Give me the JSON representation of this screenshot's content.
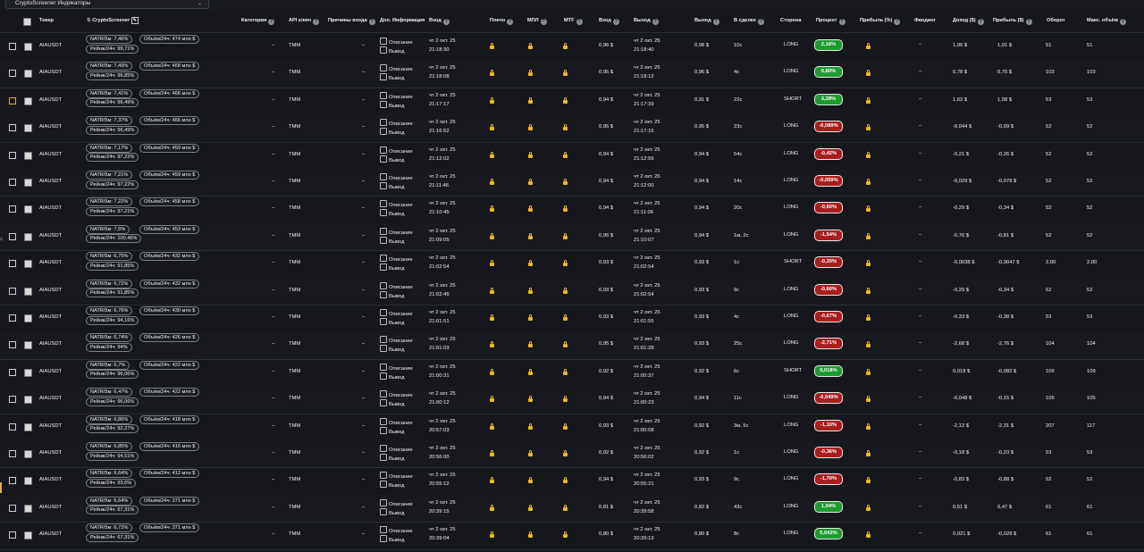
{
  "toolbar": {
    "dropdown_label": "CryptoScreener Индикаторы",
    "dropdown_arrow": "⌄"
  },
  "columns": {
    "ticker": "Тикер",
    "cryptoscreener": "CryptoScreener",
    "category": "Категория",
    "api_key": "API ключ",
    "entry_reasons": "Причины входа",
    "extra_info": "Доп. Информация",
    "entry": "Вход",
    "leverage": "Плечо",
    "mtf1": "МПЛ",
    "mtf2": "MTF",
    "entry_price": "Вход",
    "exit": "Выход",
    "exit_price": "Выход",
    "in_trade": "В сделке",
    "side": "Сторона",
    "percent": "Процент",
    "profit_pct": "Прибыль (%)",
    "funding": "Фандинг",
    "income": "Доход ($)",
    "profit_usd": "Прибыль ($)",
    "turnover": "Оборот",
    "max_volume": "Макс. объём"
  },
  "labels": {
    "description": "Описание",
    "conclusion": "Вывод"
  },
  "colors": {
    "positive": "#1c9b2e",
    "negative": "#a81d1d",
    "lock": "#e8b923",
    "background": "#15171c"
  },
  "rows": [
    {
      "ticker": "AIAUSDT",
      "natr": "NATR/5м: 7,46%",
      "vol": "Объём/24ч: 474 млн $",
      "chg": "Рейнж/24ч: 99,71%",
      "cat": "–",
      "api": "TMM",
      "reason": "–",
      "entry_date": "чт 2 окт. 25",
      "entry_time": "21:18:30",
      "entry_price": "0,96 $",
      "exit_date": "чт 2 окт. 25",
      "exit_time": "21:18:40",
      "exit_price": "0,98 $",
      "dur": "10с",
      "side": "LONG",
      "pct": "2,16%",
      "pos": true,
      "funding": "–",
      "income": "1,06 $",
      "profit": "1,01 $",
      "turnover": "51",
      "maxvol": "51"
    },
    {
      "ticker": "AIAUSDT",
      "natr": "NATR/5м: 7,49%",
      "vol": "Объём/24ч: 468 млн $",
      "chg": "Рейнж/24ч: 96,85%",
      "cat": "–",
      "api": "TMM",
      "reason": "–",
      "entry_date": "чт 2 окт. 25",
      "entry_time": "21:18:08",
      "entry_price": "0,95 $",
      "exit_date": "чт 2 окт. 25",
      "exit_time": "21:18:12",
      "exit_price": "0,96 $",
      "dur": "4с",
      "side": "LONG",
      "pct": "0,80%",
      "pos": true,
      "funding": "–",
      "income": "0,78 $",
      "profit": "0,70 $",
      "turnover": "103",
      "maxvol": "103"
    },
    {
      "ticker": "AIAUSDT",
      "natr": "NATR/5м: 7,41%",
      "vol": "Объём/24ч: 466 млн $",
      "chg": "Рейнж/24ч: 96,49%",
      "cat": "–",
      "api": "TMM",
      "reason": "–",
      "entry_date": "чт 2 окт. 25",
      "entry_time": "21:17:17",
      "entry_price": "0,94 $",
      "exit_date": "чт 2 окт. 25",
      "exit_time": "21:17:39",
      "exit_price": "0,91 $",
      "dur": "22с",
      "side": "SHORT",
      "pct": "3,28%",
      "pos": true,
      "funding": "–",
      "income": "1,63 $",
      "profit": "1,58 $",
      "turnover": "53",
      "maxvol": "53",
      "gold": true
    },
    {
      "ticker": "AIAUSDT",
      "natr": "NATR/5м: 7,37%",
      "vol": "Объём/24ч: 466 млн $",
      "chg": "Рейнж/24ч: 96,49%",
      "cat": "–",
      "api": "TMM",
      "reason": "–",
      "entry_date": "чт 2 окт. 25",
      "entry_time": "21:16:52",
      "entry_price": "0,95 $",
      "exit_date": "чт 2 окт. 25",
      "exit_time": "21:17:15",
      "exit_price": "0,95 $",
      "dur": "23с",
      "side": "LONG",
      "pct": "-0,089%",
      "pos": false,
      "funding": "–",
      "income": "-0,044 $",
      "profit": "-0,09 $",
      "turnover": "52",
      "maxvol": "52"
    },
    {
      "ticker": "AIAUSDT",
      "natr": "NATR/5м: 7,17%",
      "vol": "Объём/24ч: 459 млн $",
      "chg": "Рейнж/24ч: 97,22%",
      "cat": "–",
      "api": "TMM",
      "reason": "–",
      "entry_date": "чт 2 окт. 25",
      "entry_time": "21:12:02",
      "entry_price": "0,94 $",
      "exit_date": "чт 2 окт. 25",
      "exit_time": "21:12:56",
      "exit_price": "0,94 $",
      "dur": "54с",
      "side": "LONG",
      "pct": "-0,42%",
      "pos": false,
      "funding": "–",
      "income": "-0,21 $",
      "profit": "-0,26 $",
      "turnover": "52",
      "maxvol": "52"
    },
    {
      "ticker": "AIAUSDT",
      "natr": "NATR/5м: 7,21%",
      "vol": "Объём/24ч: 459 млн $",
      "chg": "Рейнж/24ч: 97,22%",
      "cat": "–",
      "api": "TMM",
      "reason": "–",
      "entry_date": "чт 2 окт. 25",
      "entry_time": "21:11:46",
      "entry_price": "0,94 $",
      "exit_date": "чт 2 окт. 25",
      "exit_time": "21:12:00",
      "exit_price": "0,94 $",
      "dur": "14с",
      "side": "LONG",
      "pct": "-0,059%",
      "pos": false,
      "funding": "–",
      "income": "-0,029 $",
      "profit": "-0,078 $",
      "turnover": "52",
      "maxvol": "52"
    },
    {
      "ticker": "AIAUSDT",
      "natr": "NATR/5м: 7,22%",
      "vol": "Объём/24ч: 458 млн $",
      "chg": "Рейнж/24ч: 97,21%",
      "cat": "–",
      "api": "TMM",
      "reason": "–",
      "entry_date": "чт 2 окт. 25",
      "entry_time": "21:10:45",
      "entry_price": "0,94 $",
      "exit_date": "чт 2 окт. 25",
      "exit_time": "21:11:06",
      "exit_price": "0,94 $",
      "dur": "20с",
      "side": "LONG",
      "pct": "-0,60%",
      "pos": false,
      "funding": "–",
      "income": "-0,29 $",
      "profit": "-0,34 $",
      "turnover": "52",
      "maxvol": "52"
    },
    {
      "ticker": "AIAUSDT",
      "natr": "NATR/5м: 7,5%",
      "vol": "Объём/24ч: 453 млн $",
      "chg": "Рейнж/24ч: 100,46%",
      "cat": "–",
      "api": "TMM",
      "reason": "–",
      "entry_date": "чт 2 окт. 25",
      "entry_time": "21:09:05",
      "entry_price": "0,95 $",
      "exit_date": "чт 2 окт. 25",
      "exit_time": "21:10:07",
      "exit_price": "0,94 $",
      "dur": "1м, 2с",
      "side": "LONG",
      "pct": "-1,54%",
      "pos": false,
      "funding": "–",
      "income": "-0,76 $",
      "profit": "-0,81 $",
      "turnover": "52",
      "maxvol": "52"
    },
    {
      "ticker": "AIAUSDT",
      "natr": "NATR/5м: 6,75%",
      "vol": "Объём/24ч: 432 млн $",
      "chg": "Рейнж/24ч: 91,85%",
      "cat": "–",
      "api": "TMM",
      "reason": "–",
      "entry_date": "чт 2 окт. 25",
      "entry_time": "21:02:54",
      "entry_price": "0,93 $",
      "exit_date": "чт 2 окт. 25",
      "exit_time": "21:02:54",
      "exit_price": "0,93 $",
      "dur": "1с",
      "side": "SHORT",
      "pct": "-0,20%",
      "pos": false,
      "funding": "–",
      "income": "-0,0038 $",
      "profit": "-0,0047 $",
      "turnover": "2,00",
      "maxvol": "2,00"
    },
    {
      "ticker": "AIAUSDT",
      "natr": "NATR/5м: 6,72%",
      "vol": "Объём/24ч: 432 млн $",
      "chg": "Рейнж/24ч: 91,85%",
      "cat": "–",
      "api": "TMM",
      "reason": "–",
      "entry_date": "чт 2 окт. 25",
      "entry_time": "21:02:45",
      "entry_price": "0,93 $",
      "exit_date": "чт 2 окт. 25",
      "exit_time": "21:02:54",
      "exit_price": "0,93 $",
      "dur": "9с",
      "side": "LONG",
      "pct": "-0,60%",
      "pos": false,
      "funding": "–",
      "income": "-0,29 $",
      "profit": "-0,34 $",
      "turnover": "52",
      "maxvol": "52"
    },
    {
      "ticker": "AIAUSDT",
      "natr": "NATR/5м: 6,76%",
      "vol": "Объём/24ч: 430 млн $",
      "chg": "Рейнж/24ч: 94,16%",
      "cat": "–",
      "api": "TMM",
      "reason": "–",
      "entry_date": "чт 2 окт. 25",
      "entry_time": "21:01:51",
      "entry_price": "0,93 $",
      "exit_date": "чт 2 окт. 25",
      "exit_time": "21:01:55",
      "exit_price": "0,93 $",
      "dur": "4с",
      "side": "LONG",
      "pct": "-0,67%",
      "pos": false,
      "funding": "–",
      "income": "-0,33 $",
      "profit": "-0,38 $",
      "turnover": "53",
      "maxvol": "53"
    },
    {
      "ticker": "AIAUSDT",
      "natr": "NATR/5м: 6,74%",
      "vol": "Объём/24ч: 426 млн $",
      "chg": "Рейнж/24ч: 94%",
      "cat": "–",
      "api": "TMM",
      "reason": "–",
      "entry_date": "чт 2 окт. 25",
      "entry_time": "21:01:03",
      "entry_price": "0,95 $",
      "exit_date": "чт 2 окт. 25",
      "exit_time": "21:01:28",
      "exit_price": "0,93 $",
      "dur": "25с",
      "side": "LONG",
      "pct": "-2,71%",
      "pos": false,
      "funding": "–",
      "income": "-2,68 $",
      "profit": "-2,76 $",
      "turnover": "104",
      "maxvol": "104"
    },
    {
      "ticker": "AIAUSDT",
      "natr": "NATR/5м: 6,7%",
      "vol": "Объём/24ч: 422 млн $",
      "chg": "Рейнж/24ч: 96,06%",
      "cat": "–",
      "api": "TMM",
      "reason": "–",
      "entry_date": "чт 2 окт. 25",
      "entry_time": "21:00:31",
      "entry_price": "0,92 $",
      "exit_date": "чт 2 окт. 25",
      "exit_time": "21:00:37",
      "exit_price": "0,92 $",
      "dur": "6с",
      "side": "SHORT",
      "pct": "0,018%",
      "pos": true,
      "funding": "–",
      "income": "0,018 $",
      "profit": "-0,082 $",
      "turnover": "109",
      "maxvol": "109"
    },
    {
      "ticker": "AIAUSDT",
      "natr": "NATR/5м: 6,47%",
      "vol": "Объём/24ч: 422 млн $",
      "chg": "Рейнж/24ч: 96,06%",
      "cat": "–",
      "api": "TMM",
      "reason": "–",
      "entry_date": "чт 2 окт. 25",
      "entry_time": "21:00:12",
      "entry_price": "0,94 $",
      "exit_date": "чт 2 окт. 25",
      "exit_time": "21:00:23",
      "exit_price": "0,94 $",
      "dur": "11с",
      "side": "LONG",
      "pct": "-0,049%",
      "pos": false,
      "funding": "–",
      "income": "-0,048 $",
      "profit": "-0,15 $",
      "turnover": "105",
      "maxvol": "105"
    },
    {
      "ticker": "AIAUSDT",
      "natr": "NATR/5м: 6,86%",
      "vol": "Объём/24ч: 418 млн $",
      "chg": "Рейнж/24ч: 92,27%",
      "cat": "–",
      "api": "TMM",
      "reason": "–",
      "entry_date": "чт 2 окт. 25",
      "entry_time": "20:57:03",
      "entry_price": "0,93 $",
      "exit_date": "чт 2 окт. 25",
      "exit_time": "21:00:08",
      "exit_price": "0,92 $",
      "dur": "3м, 5с",
      "side": "LONG",
      "pct": "-1,10%",
      "pos": false,
      "funding": "–",
      "income": "-2,12 $",
      "profit": "-2,31 $",
      "turnover": "207",
      "maxvol": "117"
    },
    {
      "ticker": "AIAUSDT",
      "natr": "NATR/5м: 6,85%",
      "vol": "Объём/24ч: 416 млн $",
      "chg": "Рейнж/24ч: 94,51%",
      "cat": "–",
      "api": "TMM",
      "reason": "–",
      "entry_date": "чт 2 окт. 25",
      "entry_time": "20:56:00",
      "entry_price": "0,92 $",
      "exit_date": "чт 2 окт. 25",
      "exit_time": "20:56:02",
      "exit_price": "0,92 $",
      "dur": "1с",
      "side": "LONG",
      "pct": "-0,36%",
      "pos": false,
      "funding": "–",
      "income": "-0,18 $",
      "profit": "-0,23 $",
      "turnover": "53",
      "maxvol": "53"
    },
    {
      "ticker": "AIAUSDT",
      "natr": "NATR/5м: 6,64%",
      "vol": "Объём/24ч: 412 млн $",
      "chg": "Рейнж/24ч: 93,6%",
      "cat": "–",
      "api": "TMM",
      "reason": "–",
      "entry_date": "чт 2 окт. 25",
      "entry_time": "20:55:12",
      "entry_price": "0,94 $",
      "exit_date": "чт 2 окт. 25",
      "exit_time": "20:55:21",
      "exit_price": "0,93 $",
      "dur": "9с",
      "side": "LONG",
      "pct": "-1,70%",
      "pos": false,
      "funding": "–",
      "income": "-0,83 $",
      "profit": "-0,88 $",
      "turnover": "52",
      "maxvol": "52"
    },
    {
      "ticker": "AIAUSDT",
      "natr": "NATR/5м: 6,64%",
      "vol": "Объём/24ч: 371 млн $",
      "chg": "Рейнж/24ч: 67,31%",
      "cat": "–",
      "api": "TMM",
      "reason": "–",
      "entry_date": "чт 2 окт. 25",
      "entry_time": "20:39:15",
      "entry_price": "0,81 $",
      "exit_date": "чт 2 окт. 25",
      "exit_time": "20:39:58",
      "exit_price": "0,82 $",
      "dur": "43с",
      "side": "LONG",
      "pct": "1,04%",
      "pos": true,
      "funding": "–",
      "income": "0,51 $",
      "profit": "0,47 $",
      "turnover": "61",
      "maxvol": "61"
    },
    {
      "ticker": "AIAUSDT",
      "natr": "NATR/5м: 6,72%",
      "vol": "Объём/24ч: 371 млн $",
      "chg": "Рейнж/24ч: 67,31%",
      "cat": "–",
      "api": "TMM",
      "reason": "–",
      "entry_date": "чт 2 окт. 25",
      "entry_time": "20:39:04",
      "entry_price": "0,80 $",
      "exit_date": "чт 2 окт. 25",
      "exit_time": "20:39:13",
      "exit_price": "0,80 $",
      "dur": "8с",
      "side": "LONG",
      "pct": "0,042%",
      "pos": true,
      "funding": "–",
      "income": "0,021 $",
      "profit": "-0,028 $",
      "turnover": "61",
      "maxvol": "61"
    }
  ]
}
